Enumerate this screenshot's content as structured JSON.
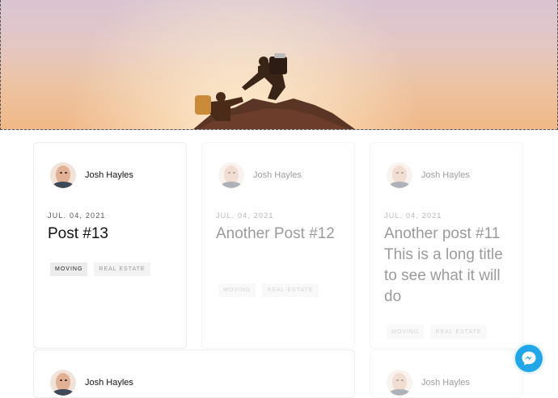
{
  "posts": [
    {
      "author": "Josh Hayles",
      "date": "JUL. 04, 2021",
      "title": "Post #13",
      "tags": [
        "MOVING",
        "REAL ESTATE"
      ]
    },
    {
      "author": "Josh Hayles",
      "date": "JUL. 04, 2021",
      "title": "Another Post #12",
      "tags": [
        "MOVING",
        "REAL ESTATE"
      ]
    },
    {
      "author": "Josh Hayles",
      "date": "JUL. 04, 2021",
      "title": "Another post #11 This is a long title to see what it will do",
      "tags": [
        "MOVING",
        "REAL ESTATE"
      ]
    },
    {
      "author": "Josh Hayles"
    },
    {
      "author": "Josh Hayles"
    }
  ],
  "icons": {
    "hero": "mountain-climbers-image",
    "chat": "messenger-icon"
  },
  "colors": {
    "messenger": "#21a7e8"
  }
}
